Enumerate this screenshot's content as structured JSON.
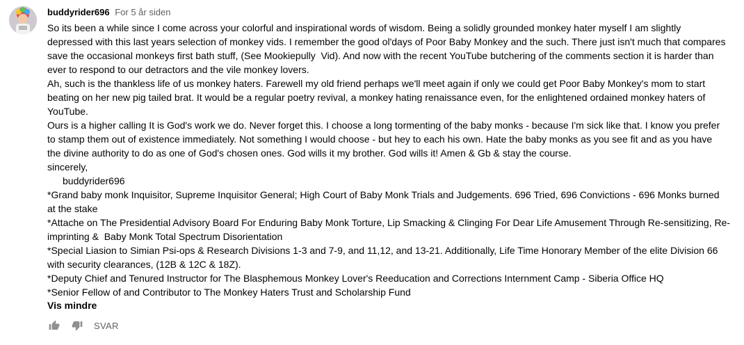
{
  "comment": {
    "author": "buddyrider696",
    "timestamp": "For 5 år siden",
    "body_lines": [
      "So its been a while since I come across your colorful and inspirational words of wisdom. Being a solidly grounded monkey hater myself I am slightly",
      "depressed with this last years selection of monkey vids. I remember the good ol'days of Poor Baby Monkey and the such. There just isn't much that compares",
      "save the occasional monkeys first bath stuff, (See Mookiepully  Vid). And now with the recent YouTube butchering of the comments section it is harder than",
      "ever to respond to our detractors and the vile monkey lovers.",
      "Ah, such is the thankless life of us monkey haters. Farewell my old friend perhaps we'll meet again if only we could get Poor Baby Monkey's mom to start",
      "beating on her new pig tailed brat. It would be a regular poetry revival, a monkey hating renaissance even, for the enlightened ordained monkey haters of",
      "YouTube.",
      "Ours is a higher calling It is God's work we do. Never forget this. I choose a long tormenting of the baby monks - because I'm sick like that. I know you prefer",
      "to stamp them out of existence immediately. Not something I would choose - but hey to each his own. Hate the baby monks as you see fit and as you have",
      "the divine authority to do as one of God's chosen ones. God wills it my brother. God wills it! Amen & Gb & stay the course.",
      "sincerely,",
      "buddyrider696",
      "*Grand baby monk Inquisitor, Supreme Inquisitor General; High Court of Baby Monk Trials and Judgements. 696 Tried, 696 Convictions - 696 Monks burned",
      "at the stake",
      "*Attache on The Presidential Advisory Board For Enduring Baby Monk Torture, Lip Smacking & Clinging For Dear Life Amusement Through Re-sensitizing, Re-",
      "imprinting &  Baby Monk Total Spectrum Disorientation",
      "*Special Liasion to Simian Psi-ops & Research Divisions 1-3 and 7-9, and 11,12, and 13-21. Additionally, Life Time Honorary Member of the elite Division 66",
      "with security clearances, (12B & 12C & 18Z).",
      "*Deputy Chief and Tenured Instructor for The Blasphemous Monkey Lover's Reeducation and Corrections Internment Camp - Siberia Office HQ",
      "*Senior Fellow of and Contributor to The Monkey Haters Trust and Scholarship Fund"
    ],
    "show_less": "Vis mindre"
  },
  "actions": {
    "like_icon": "thumbs-up-icon",
    "dislike_icon": "thumbs-down-icon",
    "reply_label": "SVAR"
  },
  "colors": {
    "text": "#030303",
    "secondary": "#606060",
    "icon": "#909090"
  }
}
